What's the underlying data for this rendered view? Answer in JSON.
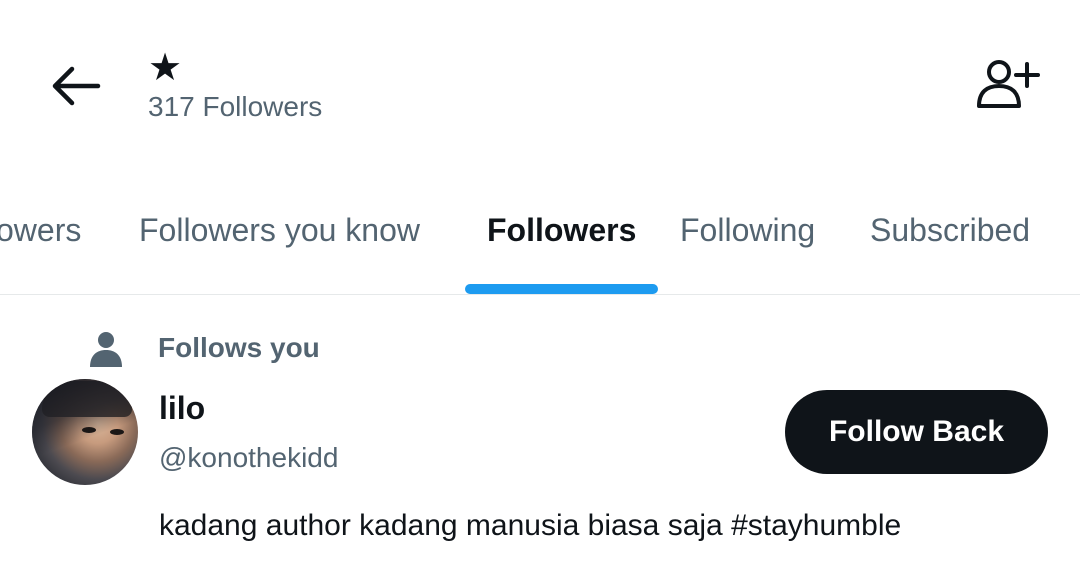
{
  "header": {
    "title": "★",
    "subtitle": "317 Followers",
    "back_icon": "arrow-left-icon",
    "add_user_icon": "person-plus-icon"
  },
  "tabs": [
    {
      "label": "owers",
      "active": false
    },
    {
      "label": "Followers you know",
      "active": false
    },
    {
      "label": "Followers",
      "active": true
    },
    {
      "label": "Following",
      "active": false
    },
    {
      "label": "Subscribed",
      "active": false
    }
  ],
  "colors": {
    "accent": "#1d9bf0",
    "text_primary": "#0f1419",
    "text_secondary": "#536471",
    "button_bg": "#0f1419",
    "button_text": "#ffffff"
  },
  "list": {
    "items": [
      {
        "context_label": "Follows you",
        "context_icon": "person-icon",
        "name": "lilo",
        "handle": "@konothekidd",
        "button_label": "Follow Back",
        "bio": "kadang author kadang manusia biasa saja #stayhumble"
      }
    ]
  }
}
